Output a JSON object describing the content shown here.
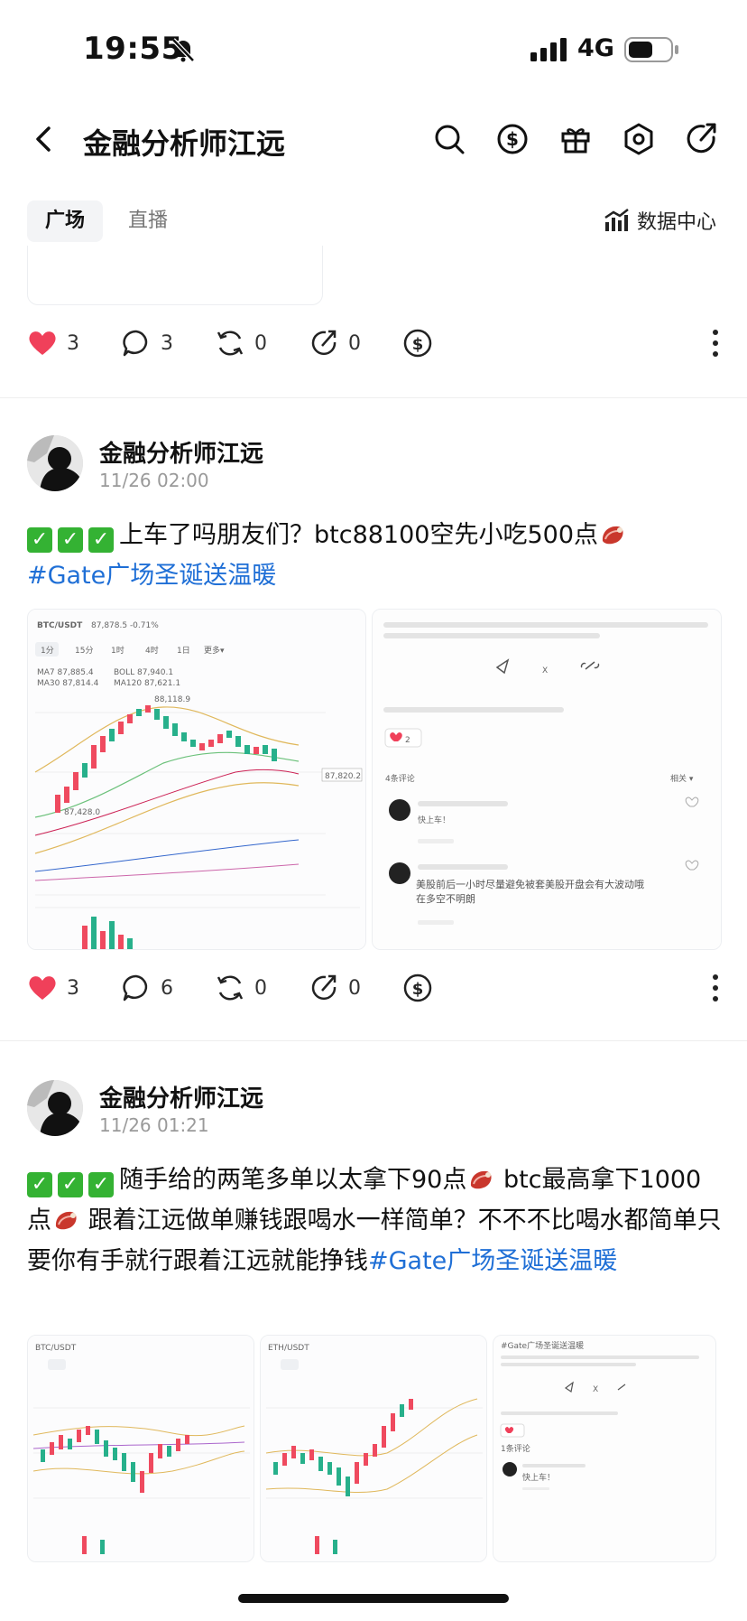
{
  "status_bar": {
    "time": "19:55",
    "network": "4G",
    "icons": [
      "mute-bell-icon",
      "signal-icon",
      "battery-icon"
    ]
  },
  "header": {
    "title": "金融分析师江远",
    "icons": [
      "back-icon",
      "search-icon",
      "dollar-coin-icon",
      "gift-icon",
      "settings-icon",
      "share-icon"
    ]
  },
  "tabs": [
    {
      "label": "广场",
      "active": true
    },
    {
      "label": "直播",
      "active": false
    }
  ],
  "data_center": {
    "label": "数据中心",
    "icon": "chart-icon"
  },
  "posts": [
    {
      "stats": {
        "likes": "3",
        "comments": "3",
        "reposts": "0",
        "shares": "0"
      }
    },
    {
      "author": "金融分析师江远",
      "time": "11/26 02:00",
      "text": "上车了吗朋友们？btc88100空先小吃500点",
      "hashtag": "#Gate广场圣诞送温暖",
      "images": {
        "chart1": {
          "pair": "BTC/USDT",
          "price_label": "87,878.5 -0.71%",
          "high_label": "88,118.9",
          "low_label": "87,428.0",
          "last_label": "87,820.2"
        },
        "comments": {
          "count_label": "4条评论",
          "c1": "快上车！",
          "c2": "美股前后一小时尽量避免被套美股开盘会有大波动哦在多空不明朗"
        }
      },
      "stats": {
        "likes": "3",
        "comments": "6",
        "reposts": "0",
        "shares": "0"
      }
    },
    {
      "author": "金融分析师江远",
      "time": "11/26 01:21",
      "text": "随手给的两笔多单以太拿下90点",
      "text2": "btc最高拿下1000点",
      "text3": "跟着江远做单赚钱跟喝水一样简单？不不不比喝水都简单只要你有手就行跟着江远就能挣钱",
      "hashtag": "#Gate广场圣诞送温暖",
      "images": {
        "chart1": {
          "pair": "BTC/USDT"
        },
        "chart2": {
          "pair": "ETH/USDT"
        },
        "comments": {
          "tag": "#Gate广场圣诞送温暖",
          "count_label": "1条评论",
          "c1": "快上车！"
        }
      }
    }
  ],
  "colors": {
    "like": "#f0405a",
    "hashtag": "#1f6fd6",
    "check": "#34b233",
    "up": "#ef4a5f",
    "down": "#27b08b"
  }
}
